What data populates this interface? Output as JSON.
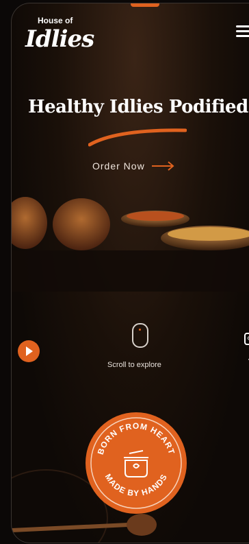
{
  "brand": {
    "top": "House of",
    "main": "Idlies"
  },
  "hero": {
    "headline": "Healthy Idlies Podified",
    "cta": "Order Now"
  },
  "scroll": {
    "label": "Scroll to explore"
  },
  "badge": {
    "top_text": "BORN FROM HEART",
    "bottom_text": "MADE BY HANDS"
  },
  "icons": [
    "menu-icon",
    "arrow-right-icon",
    "play-icon",
    "mouse-icon",
    "instagram-icon",
    "facebook-icon",
    "pot-icon"
  ],
  "colors": {
    "accent": "#e0621f",
    "background": "#0e0906"
  }
}
